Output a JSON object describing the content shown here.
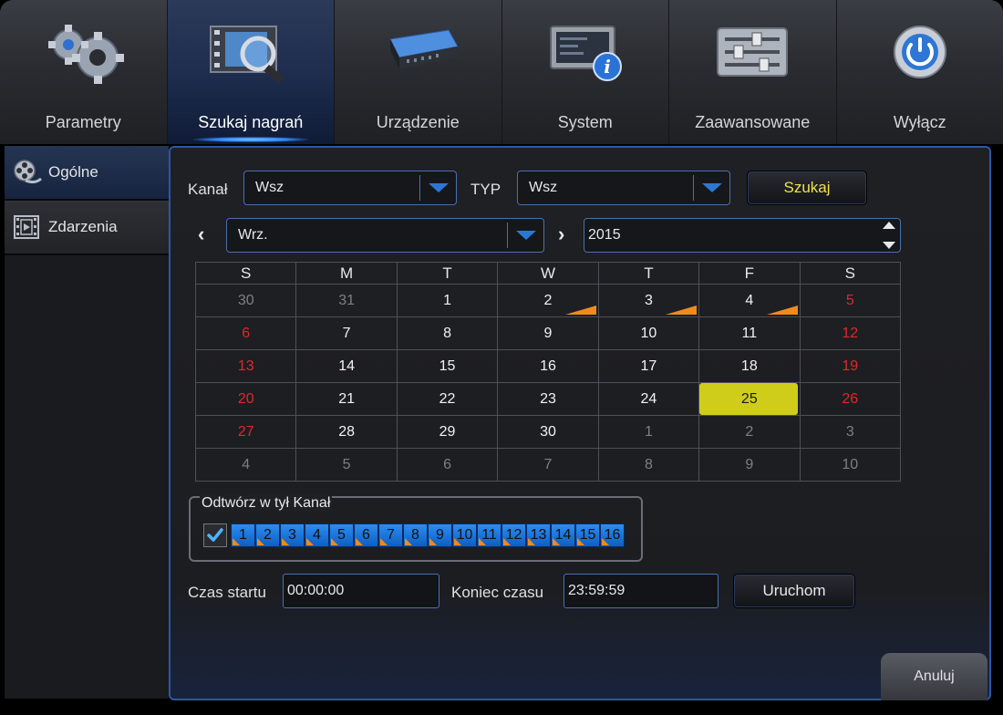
{
  "nav": {
    "items": [
      {
        "label": "Parametry",
        "icon": "gears-icon"
      },
      {
        "label": "Szukaj nagrań",
        "icon": "film-search-icon",
        "active": true
      },
      {
        "label": "Urządzenie",
        "icon": "hard-drive-icon"
      },
      {
        "label": "System",
        "icon": "monitor-info-icon"
      },
      {
        "label": "Zaawansowane",
        "icon": "sliders-icon"
      },
      {
        "label": "Wyłącz",
        "icon": "power-icon"
      }
    ]
  },
  "sidebar": {
    "items": [
      {
        "label": "Ogólne",
        "icon": "film-reel-icon",
        "active": true
      },
      {
        "label": "Zdarzenia",
        "icon": "video-frame-icon"
      }
    ]
  },
  "search": {
    "channel_label": "Kanał",
    "channel_value": "Wsz",
    "type_label": "TYP",
    "type_value": "Wsz",
    "search_button": "Szukaj"
  },
  "calendar": {
    "month_value": "Wrz.",
    "year_value": "2015",
    "weekdays": [
      "S",
      "M",
      "T",
      "W",
      "T",
      "F",
      "S"
    ],
    "weeks": [
      [
        "30",
        "31",
        "1",
        "2",
        "3",
        "4",
        "5"
      ],
      [
        "6",
        "7",
        "8",
        "9",
        "10",
        "11",
        "12"
      ],
      [
        "13",
        "14",
        "15",
        "16",
        "17",
        "18",
        "19"
      ],
      [
        "20",
        "21",
        "22",
        "23",
        "24",
        "25",
        "26"
      ],
      [
        "27",
        "28",
        "29",
        "30",
        "1",
        "2",
        "3"
      ],
      [
        "4",
        "5",
        "6",
        "7",
        "8",
        "9",
        "10"
      ]
    ],
    "selected_day": "25",
    "days_with_recordings": [
      "2",
      "3",
      "4"
    ]
  },
  "playback": {
    "group_label": "Odtwórz w tył Kanał",
    "select_all_checked": true,
    "channels": [
      "1",
      "2",
      "3",
      "4",
      "5",
      "6",
      "7",
      "8",
      "9",
      "10",
      "11",
      "12",
      "13",
      "14",
      "15",
      "16"
    ]
  },
  "time": {
    "start_label": "Czas startu",
    "start_value": "00:00:00",
    "end_label": "Koniec czasu",
    "end_value": "23:59:59",
    "run_button": "Uruchom"
  },
  "cancel_button": "Anuluj",
  "colors": {
    "accent_blue": "#2a78d6",
    "selected_day": "#cfcd1a",
    "weekend_red": "#e02828",
    "recording_marker": "#f08a1c"
  }
}
